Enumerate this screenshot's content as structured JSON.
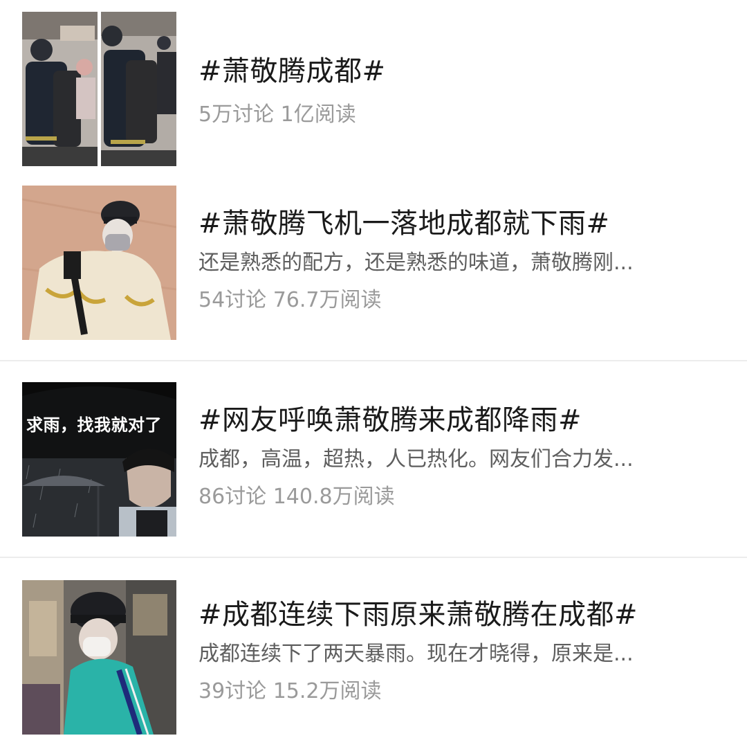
{
  "topics": [
    {
      "title": "#萧敬腾成都#",
      "description": "",
      "stats": "5万讨论 1亿阅读",
      "thumbnail_icon": "photo-two-panel"
    },
    {
      "title": "#萧敬腾飞机一落地成都就下雨#",
      "description": "还是熟悉的配方，还是熟悉的味道，萧敬腾刚...",
      "stats": "54讨论 76.7万阅读",
      "thumbnail_icon": "photo-person"
    },
    {
      "title": "#网友呼唤萧敬腾来成都降雨#",
      "description": "成都，高温，超热，人已热化。网友们合力发...",
      "stats": "86讨论 140.8万阅读",
      "thumbnail_icon": "photo-umbrella",
      "thumbnail_caption": "求雨，找我就对了"
    },
    {
      "title": "#成都连续下雨原来萧敬腾在成都#",
      "description": "成都连续下了两天暴雨。现在才晓得，原来是...",
      "stats": "39讨论 15.2万阅读",
      "thumbnail_icon": "photo-person"
    }
  ],
  "colors": {
    "background": "#ffffff",
    "title": "#1a1a1a",
    "description": "#5e5e5e",
    "stats": "#9a9a9a",
    "divider": "#ececec"
  }
}
